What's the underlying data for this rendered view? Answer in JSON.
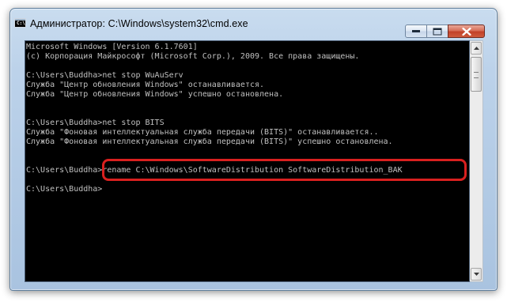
{
  "window": {
    "title": "Администратор: C:\\Windows\\system32\\cmd.exe",
    "app_icon_text": "C:\\"
  },
  "console": {
    "lines": [
      "Microsoft Windows [Version 6.1.7601]",
      "(c) Корпорация Майкрософт (Microsoft Corp.), 2009. Все права защищены.",
      "",
      "C:\\Users\\Buddha>net stop WuAuServ",
      "Служба \"Центр обновления Windows\" останавливается.",
      "Служба \"Центр обновления Windows\" успешно остановлена.",
      "",
      "",
      "C:\\Users\\Buddha>net stop BITS",
      "Служба \"Фоновая интеллектуальная служба передачи (BITS)\" останавливается..",
      "Служба \"Фоновая интеллектуальная служба передачи (BITS)\" успешно остановлена.",
      "",
      "",
      "C:\\Users\\Buddha>rename C:\\Windows\\SoftwareDistribution SoftwareDistribution_BAK",
      "",
      "C:\\Users\\Buddha>"
    ]
  },
  "colors": {
    "console_bg": "#000000",
    "console_text": "#c0c0c0",
    "highlight": "#d9201f",
    "close_button": "#c2412a"
  },
  "icons": [
    "cmd-icon",
    "minimize-icon",
    "maximize-icon",
    "close-icon",
    "scroll-up-icon",
    "scroll-down-icon"
  ]
}
